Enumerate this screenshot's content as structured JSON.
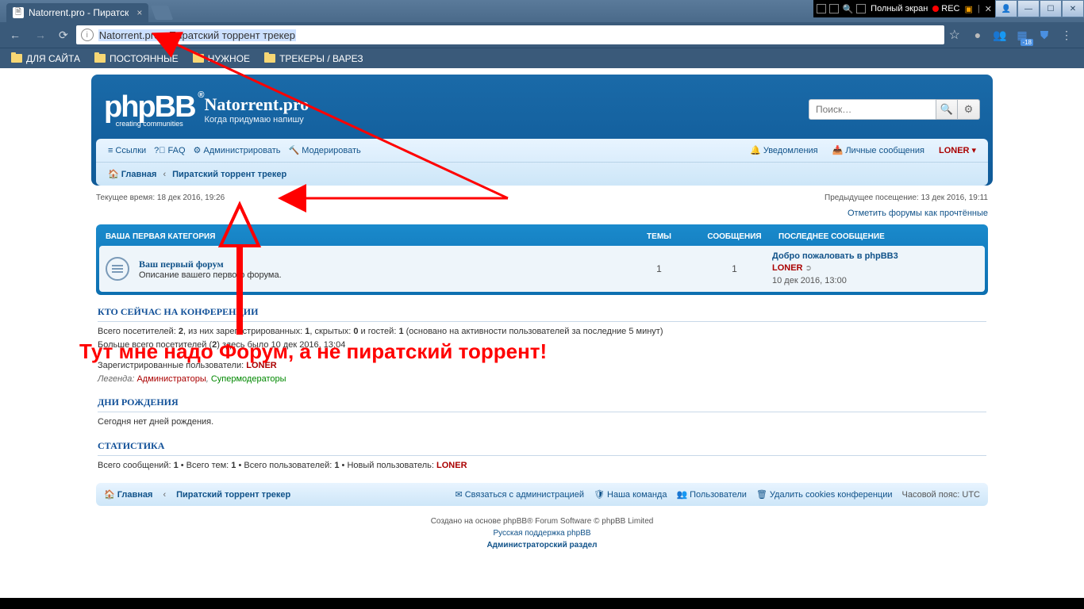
{
  "win": {
    "fullscreen_label": "Полный экран",
    "rec_label": "REC"
  },
  "browser": {
    "tab_title": "Natorrent.pro - Пиратск",
    "url_text": "Natorrent.pro - Пиратский торрент трекер",
    "bookmarks": [
      "ДЛЯ САЙТА",
      "ПОСТОЯННЫЕ",
      "НУЖНОЕ",
      "ТРЕКЕРЫ / ВАРЕЗ"
    ],
    "ext_badge": "-18"
  },
  "header": {
    "logo_main": "phpBB",
    "logo_tag": "creating   communities",
    "site_name": "Natorrent.pro",
    "site_desc": "Когда придумаю напишу",
    "search_placeholder": "Поиск…"
  },
  "nav": {
    "links": "Ссылки",
    "faq": "FAQ",
    "admin": "Администрировать",
    "moderate": "Модерировать",
    "notifications": "Уведомления",
    "pm": "Личные сообщения",
    "username": "LONER",
    "home": "Главная",
    "breadcrumb": "Пиратский торрент трекер"
  },
  "times": {
    "current": "Текущее время: 18 дек 2016, 19:26",
    "last_visit": "Предыдущее посещение: 13 дек 2016, 19:11",
    "mark_read": "Отметить форумы как прочтённые"
  },
  "category": {
    "title": "ВАША ПЕРВАЯ КАТЕГОРИЯ",
    "col_topics": "ТЕМЫ",
    "col_posts": "СООБЩЕНИЯ",
    "col_last": "ПОСЛЕДНЕЕ СООБЩЕНИЕ",
    "forum": {
      "title": "Ваш первый форум",
      "desc": "Описание вашего первого форума.",
      "topics": "1",
      "posts": "1",
      "last_title": "Добро пожаловать в phpBB3",
      "last_user": "LONER",
      "last_time": "10 дек 2016, 13:00"
    }
  },
  "whois": {
    "title": "КТО СЕЙЧАС НА КОНФЕРЕНЦИИ",
    "line1_a": "Всего посетителей: ",
    "line1_b": ", из них зарегистрированных: ",
    "line1_c": ", скрытых: ",
    "line1_d": " и гостей: ",
    "line1_e": " (основано на активности пользователей за последние 5 минут)",
    "total": "2",
    "reg": "1",
    "hidden": "0",
    "guests": "1",
    "line2_a": "Больше всего посетителей (",
    "line2_b": ") здесь было 10 дек 2016, 13:04",
    "peak": "2",
    "line3_a": "Зарегистрированные пользователи: ",
    "reg_user": "LONER",
    "legend_label": "Легенда: ",
    "group_admin": "Администраторы",
    "group_mod": "Супермодераторы"
  },
  "birthdays": {
    "title": "ДНИ РОЖДЕНИЯ",
    "body": "Сегодня нет дней рождения."
  },
  "stats": {
    "title": "СТАТИСТИКА",
    "a": "Всего сообщений: ",
    "posts": "1",
    "b": " • Всего тем: ",
    "topics": "1",
    "c": " • Всего пользователей: ",
    "users": "1",
    "d": " • Новый пользователь: ",
    "newest": "LONER"
  },
  "footer": {
    "home": "Главная",
    "breadcrumb": "Пиратский торрент трекер",
    "contact": "Связаться с администрацией",
    "team": "Наша команда",
    "members": "Пользователи",
    "delete_cookies": "Удалить cookies конференции",
    "timezone": "Часовой пояс: UTC"
  },
  "copyright": {
    "line1_a": "Создано на основе phpBB",
    "line1_b": " Forum Software © phpBB Limited",
    "line2": "Русская поддержка phpBB",
    "line3": "Администраторский раздел"
  },
  "annotation": {
    "text": "Тут мне надо Форум, а не пиратский торрент!"
  }
}
